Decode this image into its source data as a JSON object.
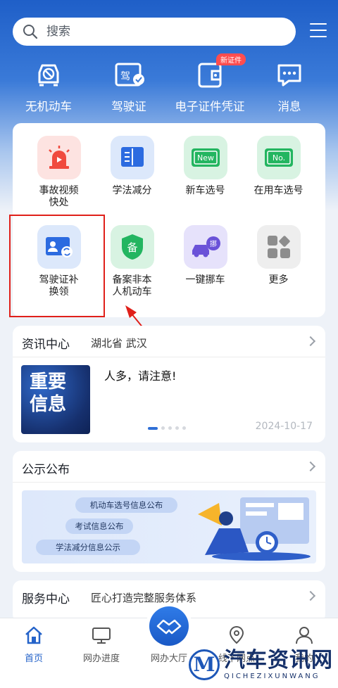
{
  "search": {
    "placeholder": "搜索"
  },
  "top_nav": [
    {
      "label": "无机动车",
      "icon": "no-vehicle-icon"
    },
    {
      "label": "驾驶证",
      "icon": "driver-license-icon"
    },
    {
      "label": "电子证件凭证",
      "icon": "e-certificate-icon",
      "badge": "新证件"
    },
    {
      "label": "消息",
      "icon": "message-icon"
    }
  ],
  "services": [
    {
      "label": "事故视频快处",
      "icon": "accident-alarm-icon"
    },
    {
      "label": "学法减分",
      "icon": "book-icon"
    },
    {
      "label": "新车选号",
      "icon": "new-plate-icon",
      "icon_text": "New"
    },
    {
      "label": "在用车选号",
      "icon": "used-plate-icon",
      "icon_text": "No."
    },
    {
      "label": "驾驶证补换领",
      "icon": "license-renew-icon"
    },
    {
      "label": "备案非本人机动车",
      "icon": "record-shield-icon",
      "icon_text": "备"
    },
    {
      "label": "一键挪车",
      "icon": "move-car-icon",
      "icon_text": "挪"
    },
    {
      "label": "更多",
      "icon": "more-icon"
    }
  ],
  "news": {
    "title": "资讯中心",
    "location": "湖北省 武汉",
    "thumb_text": "重要信息",
    "headline": "人多，请注意!",
    "date": "2024-10-17",
    "slide_index": 1,
    "slide_count": 5
  },
  "notice": {
    "title": "公示公布",
    "pills": [
      "机动车选号信息公布",
      "考试信息公布",
      "学法减分信息公示"
    ]
  },
  "service_center": {
    "title": "服务中心",
    "subtitle": "匠心打造完整服务体系"
  },
  "tabbar": [
    {
      "label": "首页",
      "icon": "home-icon",
      "active": true
    },
    {
      "label": "网办进度",
      "icon": "monitor-icon",
      "active": false
    },
    {
      "label": "网办大厅",
      "icon": "handshake-icon",
      "active": false
    },
    {
      "label": "线下网点",
      "icon": "location-pin-icon",
      "active": false
    },
    {
      "label": "我的",
      "icon": "user-icon",
      "active": false
    }
  ],
  "watermark": {
    "logo": "M",
    "main": "汽车资讯网",
    "sub": "QICHEZIXUNWANG"
  },
  "colors": {
    "primary": "#2563c9",
    "highlight": "#e0201a"
  }
}
